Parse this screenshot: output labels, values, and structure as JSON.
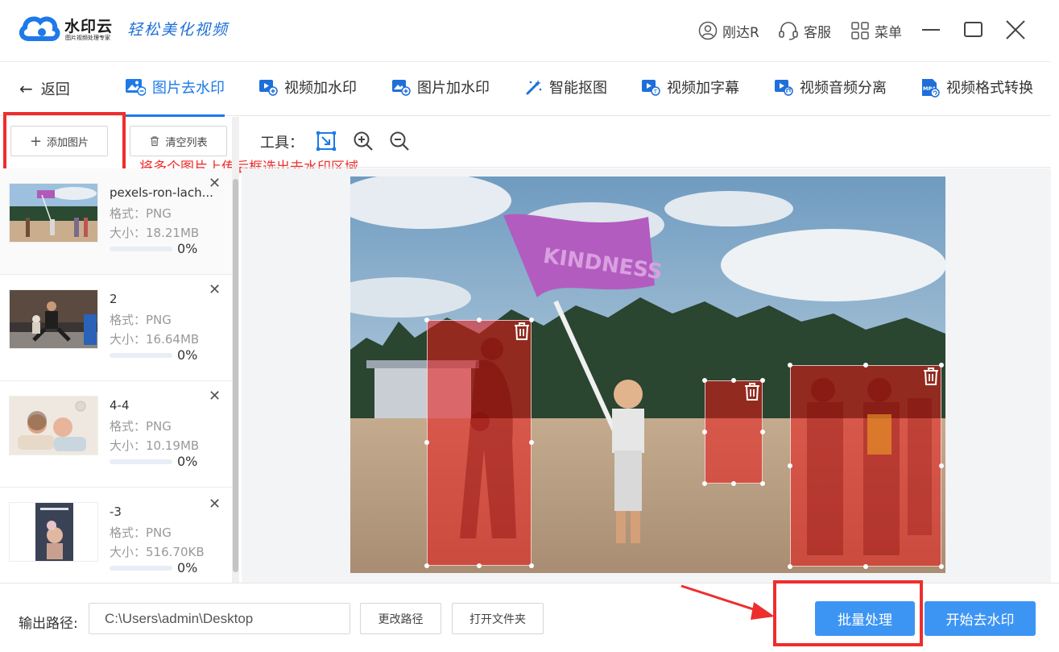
{
  "header": {
    "brand": "水印云",
    "brand_sub": "图片视频处理专家",
    "slogan": "轻松美化视频",
    "user": "刚达R",
    "service": "客服",
    "menu": "菜单"
  },
  "tabs": {
    "back": "返回",
    "items": [
      {
        "label": "图片去水印",
        "active": true,
        "icon": "image-remove-icon"
      },
      {
        "label": "视频加水印",
        "icon": "video-add-icon"
      },
      {
        "label": "图片加水印",
        "icon": "image-add-icon"
      },
      {
        "label": "智能抠图",
        "icon": "magic-wand-icon"
      },
      {
        "label": "视频加字幕",
        "icon": "video-subtitle-icon"
      },
      {
        "label": "视频音频分离",
        "icon": "video-audio-icon"
      },
      {
        "label": "视频格式转换",
        "icon": "mp4-icon"
      }
    ]
  },
  "sidebar": {
    "add_button": "添加图片",
    "add_icon": "plus-icon",
    "clear_button": "清空列表",
    "clear_icon": "trash-icon",
    "annotation": "将多个图片上传后框选出去水印区域",
    "files": [
      {
        "name": "pexels-ron-lach...",
        "format": "格式：PNG",
        "size": "大小：18.21MB",
        "progress": "0%"
      },
      {
        "name": "2",
        "format": "格式：PNG",
        "size": "大小：16.64MB",
        "progress": "0%"
      },
      {
        "name": "4-4",
        "format": "格式：PNG",
        "size": "大小：10.19MB",
        "progress": "0%"
      },
      {
        "name": "-3",
        "format": "格式：PNG",
        "size": "大小：516.70KB",
        "progress": "0%"
      }
    ]
  },
  "workspace": {
    "tools_label": "工具：",
    "tools": [
      "select-box-icon",
      "zoom-in-icon",
      "zoom-out-icon"
    ],
    "flag_text": "KINDNESS",
    "selection_count": 3
  },
  "bottom": {
    "output_label": "输出路径:",
    "output_path": "C:\\Users\\admin\\Desktop",
    "change_path": "更改路径",
    "open_folder": "打开文件夹",
    "batch": "批量处理",
    "start": "开始去水印"
  },
  "colors": {
    "accent": "#1e7ae8",
    "primary_button": "#3d95f3",
    "annotation_red": "#ee2e2e",
    "selection_fill": "#e81414"
  }
}
